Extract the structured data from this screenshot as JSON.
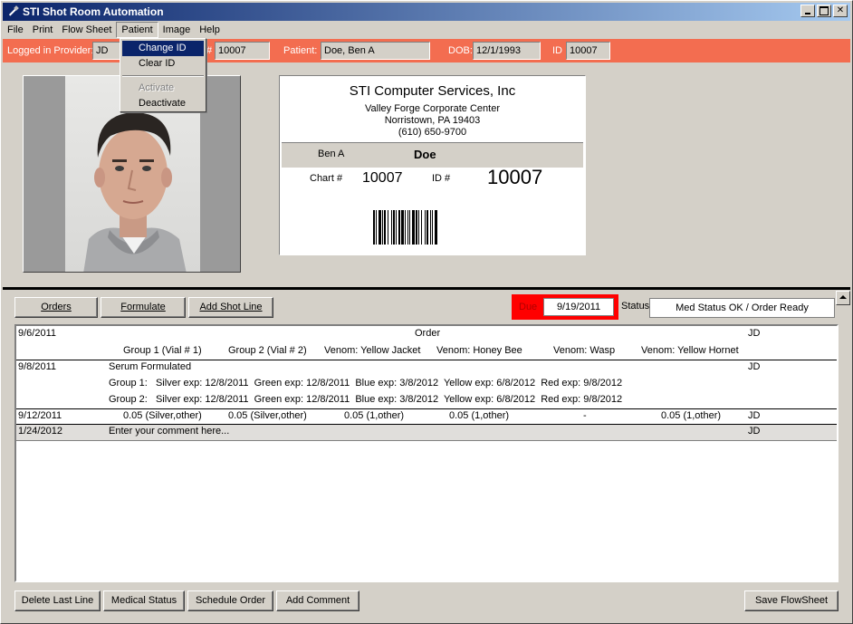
{
  "window": {
    "title": "STI Shot Room Automation"
  },
  "menu": [
    "File",
    "Print",
    "Flow Sheet",
    "Patient",
    "Image",
    "Help"
  ],
  "patient_menu": {
    "change_id": "Change ID",
    "clear_id": "Clear ID",
    "activate": "Activate",
    "deactivate": "Deactivate"
  },
  "provider_bar": {
    "logged_label": "Logged in Provider:",
    "provider": "JD",
    "chart_label": "#",
    "chart": "10007",
    "patient_label": "Patient:",
    "patient": "Doe, Ben A",
    "dob_label": "DOB:",
    "dob": "12/1/1993",
    "id_label": "ID",
    "id": "10007"
  },
  "card": {
    "company": "STI Computer Services, Inc",
    "addr1": "Valley Forge Corporate Center",
    "addr2": "Norristown, PA 19403",
    "phone": "(610) 650-9700",
    "first": "Ben A",
    "last": "Doe",
    "chart_label": "Chart #",
    "chart": "10007",
    "id_label": "ID #",
    "id": "10007"
  },
  "toolbar": {
    "orders": "Orders",
    "formulate": "Formulate",
    "add_shot_line": "Add Shot Line"
  },
  "due": {
    "label": "Due",
    "value": "9/19/2011"
  },
  "status": {
    "label": "Status",
    "value": "Med Status OK / Order Ready"
  },
  "flowsheet": {
    "order_row": {
      "date": "9/6/2011",
      "title": "Order",
      "user": "JD"
    },
    "headers": [
      "Group 1 (Vial # 1)",
      "Group 2 (Vial # 2)",
      "Venom: Yellow Jacket",
      "Venom: Honey Bee",
      "Venom: Wasp",
      "Venom: Yellow Hornet"
    ],
    "formulated": {
      "date": "9/8/2011",
      "title": "Serum Formulated",
      "user": "JD",
      "group1": "Group 1:   Silver exp: 12/8/2011  Green exp: 12/8/2011  Blue exp: 3/8/2012  Yellow exp: 6/8/2012  Red exp: 9/8/2012",
      "group2": "Group 2:   Silver exp: 12/8/2011  Green exp: 12/8/2011  Blue exp: 3/8/2012  Yellow exp: 6/8/2012  Red exp: 9/8/2012"
    },
    "shot_row": {
      "date": "9/12/2011",
      "cells": [
        "0.05 (Silver,other)",
        "0.05 (Silver,other)",
        "0.05 (1,other)",
        "0.05 (1,other)",
        "-",
        "0.05 (1,other)"
      ],
      "user": "JD"
    },
    "comment_row": {
      "date": "1/24/2012",
      "text": "Enter your comment here...",
      "user": "JD"
    }
  },
  "bottom": {
    "delete_last": "Delete Last Line",
    "medical_status": "Medical Status",
    "schedule_order": "Schedule Order",
    "add_comment": "Add Comment",
    "save": "Save FlowSheet"
  }
}
